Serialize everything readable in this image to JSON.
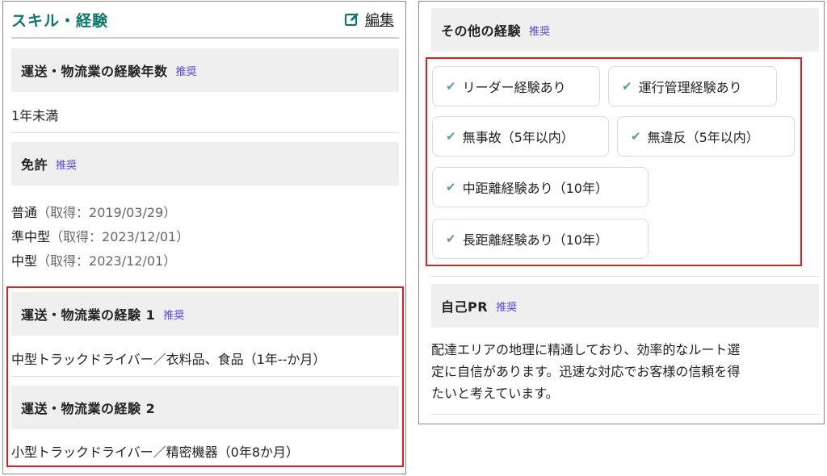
{
  "left": {
    "title": "スキル・経験",
    "edit_label": "編集",
    "sections": {
      "years": {
        "label": "運送・物流業の経験年数",
        "badge": "推奨",
        "value": "1年未満"
      },
      "license": {
        "label": "免許",
        "badge": "推奨",
        "items": [
          {
            "name": "普通",
            "detail": "（取得：2019/03/29）"
          },
          {
            "name": "準中型",
            "detail": "（取得：2023/12/01）"
          },
          {
            "name": "中型",
            "detail": "（取得：2023/12/01）"
          }
        ]
      },
      "exp1": {
        "label": "運送・物流業の経験 1",
        "badge": "推奨",
        "value": "中型トラックドライバー／衣料品、食品（1年--か月）"
      },
      "exp2": {
        "label": "運送・物流業の経験 2",
        "value": "小型トラックドライバー／精密機器（0年8か月）"
      }
    }
  },
  "right": {
    "other": {
      "label": "その他の経験",
      "badge": "推奨",
      "chips": [
        "リーダー経験あり",
        "運行管理経験あり",
        "無事故（5年以内）",
        "無違反（5年以内）",
        "中距離経験あり（10年）",
        "長距離経験あり（10年）"
      ]
    },
    "pr": {
      "label": "自己PR",
      "badge": "推奨",
      "lines": [
        "配達エリアの地理に精通しており、効率的なルート選",
        "定に自信があります。迅速な対応でお客様の信頼を得",
        "たいと考えています。"
      ]
    }
  },
  "colors": {
    "title": "#0f766e",
    "badge": "#5b44e6",
    "highlight": "#e02020",
    "check": "#5f96a8",
    "section_bg": "#efefef"
  },
  "icons": {
    "edit": "edit-square-icon",
    "check": "check-icon"
  }
}
